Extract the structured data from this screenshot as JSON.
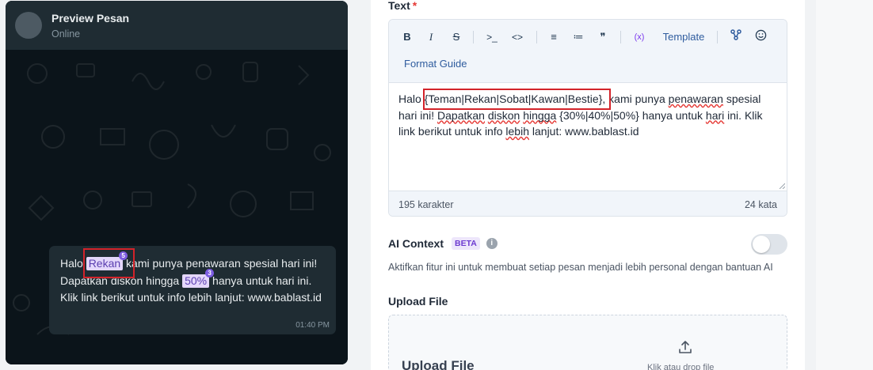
{
  "preview": {
    "title": "Preview Pesan",
    "status": "Online",
    "message": {
      "part1": "Halo ",
      "chip1": "Rekan",
      "chip1_badge": "5",
      "part2": " kami punya penawaran spesial hari ini! Dapatkan diskon hingga ",
      "chip2": "50%",
      "chip2_badge": "3",
      "part3": " hanya untuk hari ini. Klik link berikut untuk info lebih lanjut: www.bablast.id",
      "time": "01:40 PM"
    }
  },
  "form": {
    "text_label": "Text",
    "required_mark": "*",
    "toolbar": {
      "bold": "B",
      "italic": "I",
      "strike": "S",
      "code_inline": ">_",
      "code_block": "<>",
      "bullet_list": "≡",
      "numbered_list": "≔",
      "quote": "❞",
      "variable": "(x)",
      "template": "Template",
      "format_guide": "Format Guide"
    },
    "editor_text": {
      "a": "Halo ",
      "b": "{Teman|Rekan|Sobat|Kawan|Bestie}",
      "c": ", kami punya ",
      "d": "penawaran",
      "e": " spesial hari ini! ",
      "f": "Dapatkan",
      "g": " ",
      "h": "diskon",
      "i": " ",
      "j": "hingga",
      "k": " {30%|40%|50%} hanya untuk ",
      "l": "hari",
      "m": " ini. Klik link berikut untuk info ",
      "n": "lebih",
      "o": " lanjut: www.bablast.id"
    },
    "char_count": "195 karakter",
    "word_count": "24 kata",
    "ai_context": {
      "label": "AI Context",
      "badge": "BETA",
      "info": "i",
      "description": "Aktifkan fitur ini untuk membuat setiap pesan menjadi lebih personal dengan bantuan AI",
      "enabled": false
    },
    "upload": {
      "label": "Upload File",
      "title": "Upload File",
      "hint": "Klik atau drop file"
    }
  },
  "colors": {
    "accent": "#7c5ce0",
    "highlight_box": "#d3232a",
    "chat_bg": "#0b141a",
    "bubble_bg": "#1f2c33"
  }
}
